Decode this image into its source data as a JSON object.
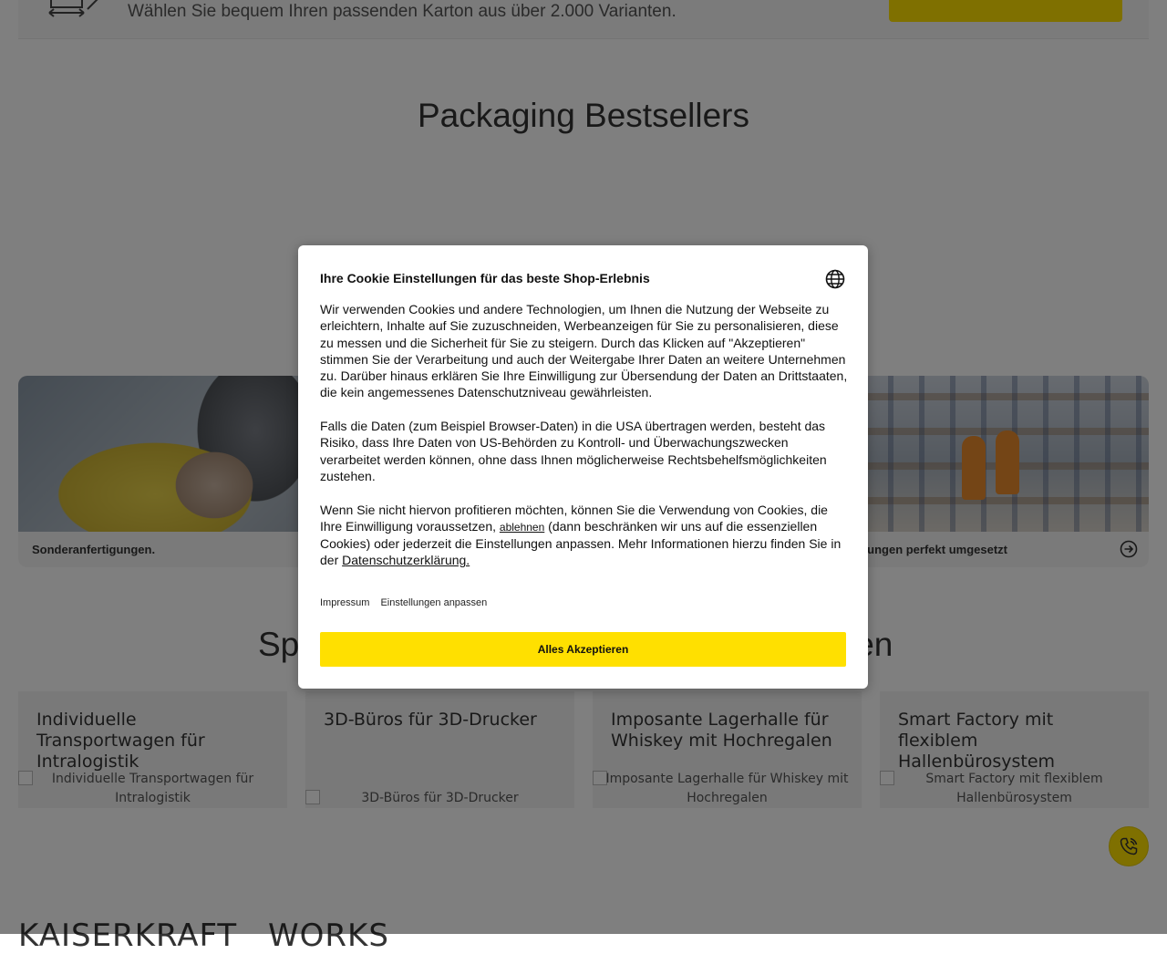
{
  "banner": {
    "text": "Wählen Sie bequem Ihren passenden Karton aus über 2.000 Varianten.",
    "icon": "box-size-icon"
  },
  "bestsellers": {
    "title": "Packaging Bestsellers"
  },
  "hero_cards": [
    {
      "caption": "Sonderanfertigungen."
    },
    {
      "caption": "ungen perfekt umgesetzt",
      "icon": "arrow-right-circle-icon"
    }
  ],
  "special_section": {
    "title_left": "Sp",
    "title_right": "len",
    "tiles": [
      {
        "title": "Individuelle Transportwagen für Intralogistik",
        "alt": "Individuelle Transportwagen für Intralogistik"
      },
      {
        "title": "3D-Büros für 3D-Drucker",
        "alt": "3D-Büros für 3D-Drucker"
      },
      {
        "title": "Imposante Lagerhalle für Whiskey mit Hochregalen",
        "alt": "Imposante Lagerhalle für Whiskey mit Hochregalen"
      },
      {
        "title": "Smart Factory mit flexiblem Hallenbürosystem",
        "alt": "Smart Factory mit flexiblem Hallenbürosystem"
      }
    ]
  },
  "brand": {
    "name": "KAISERKRAFT",
    "suffix": "WORKS"
  },
  "phone_button": {
    "icon": "phone-icon"
  },
  "cookie_modal": {
    "title": "Ihre Cookie Einstellungen für das beste Shop-Erlebnis",
    "language_icon": "globe-icon",
    "paragraph1": "Wir verwenden Cookies und andere Technologien, um Ihnen die Nutzung der Webseite zu erleichtern, Inhalte auf Sie zuzuschneiden, Werbeanzeigen für Sie zu personalisieren, diese zu messen und die Sicherheit für Sie zu steigern. Durch das Klicken auf \"Akzeptieren\" stimmen Sie der Verarbeitung und auch der Weitergabe Ihrer Daten an weitere Unternehmen zu. Darüber hinaus erklären Sie Ihre Einwilligung zur Übersendung der Daten an Drittstaaten, die kein angemessenes Datenschutzniveau gewährleisten.",
    "paragraph2": "Falls die Daten (zum Beispiel Browser-Daten) in die USA übertragen werden, besteht das Risiko, dass Ihre Daten von US-Behörden zu Kontroll- und Überwachungszwecken verarbeitet werden können, ohne dass Ihnen möglicherweise Rechtsbehelfsmöglichkeiten zustehen.",
    "paragraph3_part1": "Wenn Sie nicht hiervon profitieren möchten, können Sie die Verwendung von Cookies, die Ihre Einwilligung voraussetzen,",
    "reject_link": "ablehnen",
    "paragraph3_part2": "(dann beschränken wir uns auf die essenziellen Cookies) oder jederzeit die Einstellungen anpassen. Mehr Informationen hierzu finden Sie in der",
    "privacy_link": "Datenschutzerklärung.",
    "imprint_link": "Impressum",
    "settings_link": "Einstellungen anpassen",
    "accept_button": "Alles Akzeptieren"
  }
}
